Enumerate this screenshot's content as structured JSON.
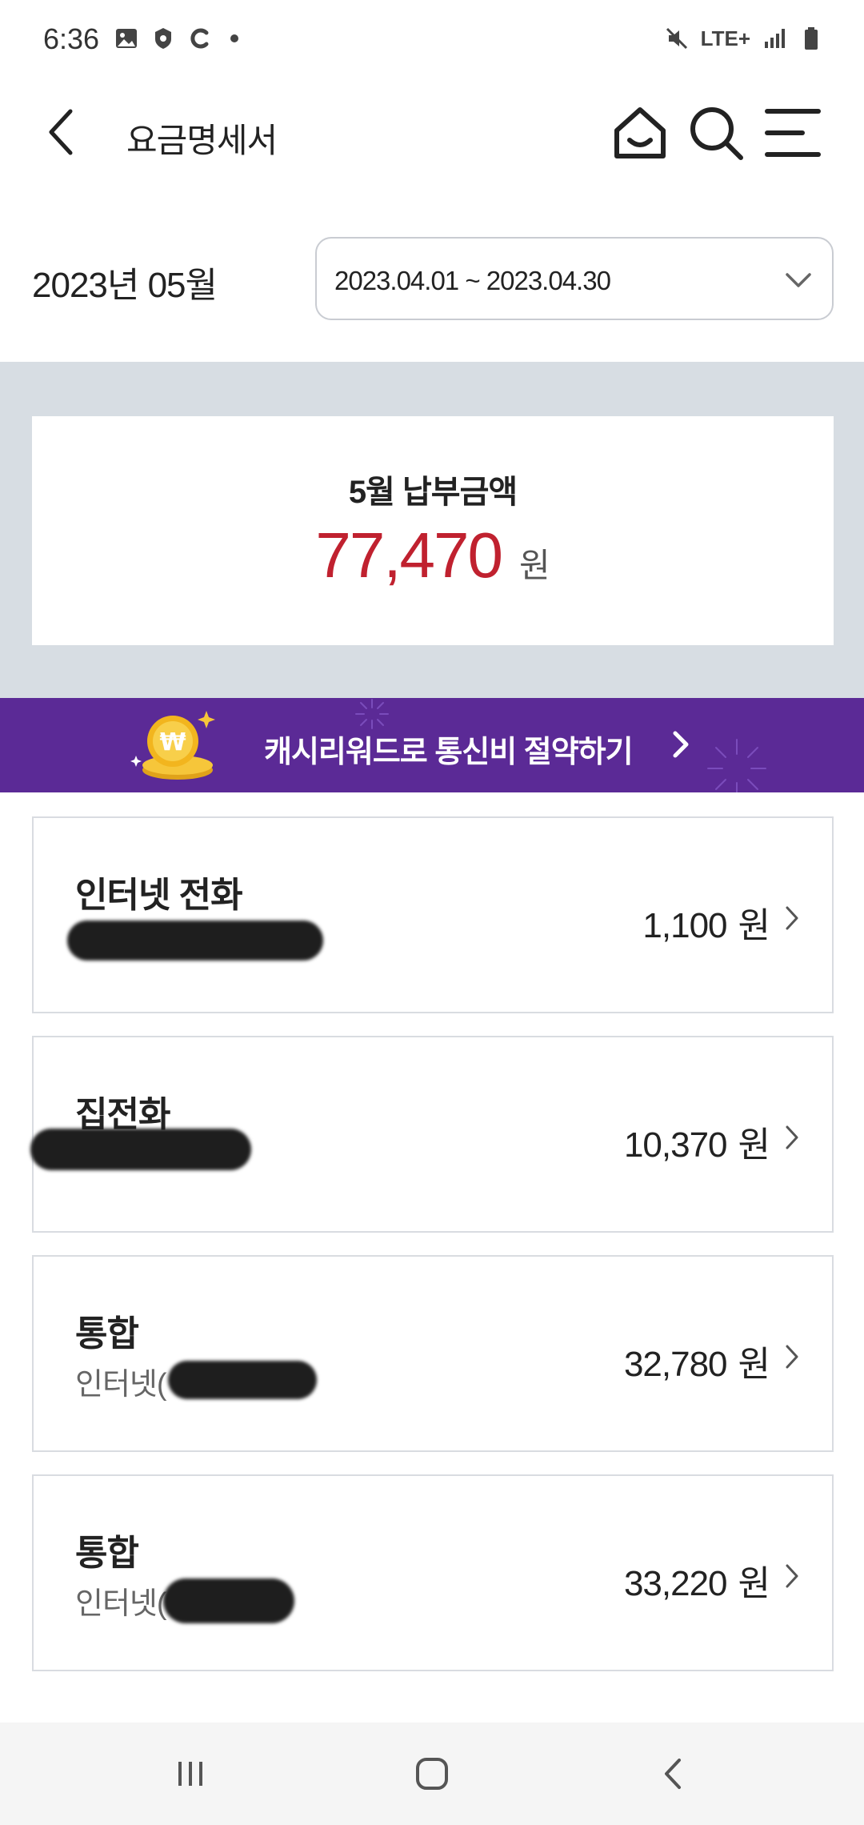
{
  "status_bar": {
    "time": "6:36",
    "network": "LTE+",
    "left_icons": [
      "gallery-icon",
      "shield-icon",
      "c-app-icon",
      "dot-icon"
    ],
    "right_icons": [
      "mute-icon",
      "lte-icon",
      "signal-icon",
      "battery-icon"
    ]
  },
  "header": {
    "title": "요금명세서",
    "icons": [
      "back-icon",
      "home-icon",
      "search-icon",
      "menu-icon"
    ]
  },
  "period": {
    "bill_month": "2023년 05월",
    "selected_range": "2023.04.01 ~ 2023.04.30"
  },
  "summary": {
    "label": "5월 납부금액",
    "amount": "77,470",
    "unit": "원",
    "amount_color": "#c0212f"
  },
  "promo": {
    "text": "캐시리워드로 통신비 절약하기",
    "background": "#5b2a96"
  },
  "items": [
    {
      "title": "인터넷 전화",
      "subtitle": "",
      "amount": "1,100",
      "unit": "원"
    },
    {
      "title": "집전화",
      "subtitle": "",
      "amount": "10,370",
      "unit": "원"
    },
    {
      "title": "통합",
      "subtitle": "인터넷(",
      "amount": "32,780",
      "unit": "원"
    },
    {
      "title": "통합",
      "subtitle": "인터넷(",
      "amount": "33,220",
      "unit": "원"
    }
  ],
  "nav": {
    "icons": [
      "recent-apps-icon",
      "home-button-icon",
      "back-button-icon"
    ]
  }
}
